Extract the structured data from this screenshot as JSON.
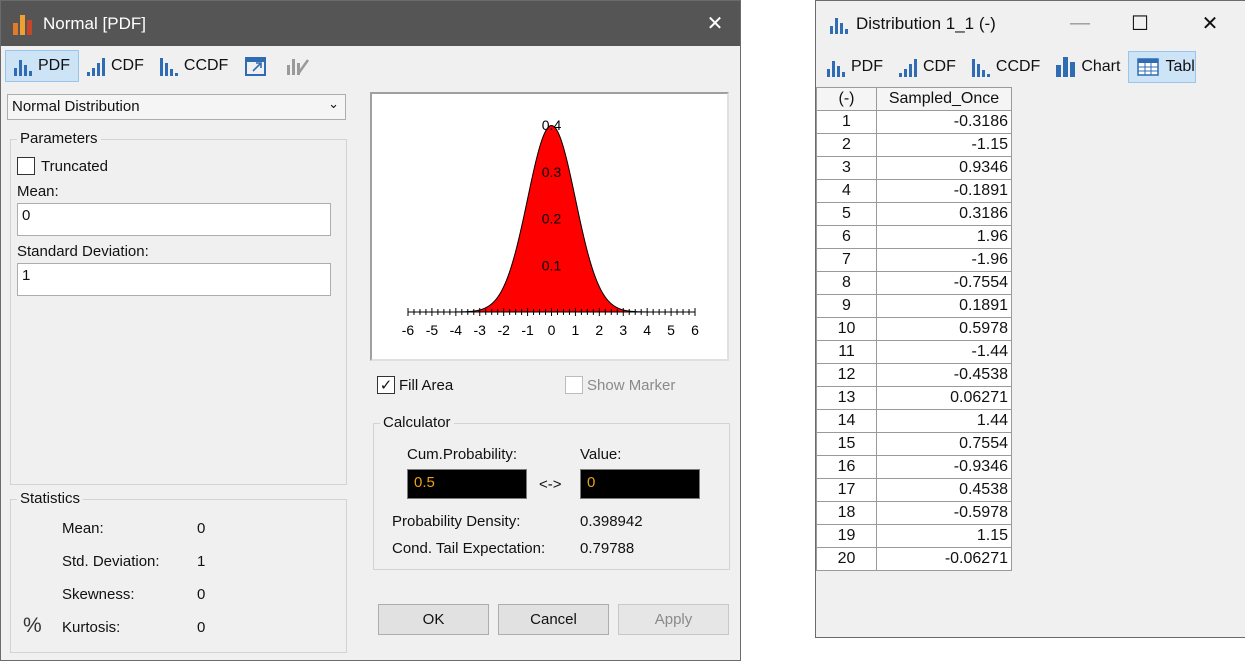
{
  "dialog": {
    "title": "Normal [PDF]",
    "toolbar": {
      "pdf": "PDF",
      "cdf": "CDF",
      "ccdf": "CCDF"
    },
    "distribution_select": "Normal Distribution",
    "parameters": {
      "group_label": "Parameters",
      "truncated_label": "Truncated",
      "mean_label": "Mean:",
      "mean_value": "0",
      "sd_label": "Standard Deviation:",
      "sd_value": "1"
    },
    "statistics": {
      "group_label": "Statistics",
      "rows": [
        {
          "label": "Mean:",
          "value": "0"
        },
        {
          "label": "Std. Deviation:",
          "value": "1"
        },
        {
          "label": "Skewness:",
          "value": "0"
        },
        {
          "label": "Kurtosis:",
          "value": "0"
        }
      ],
      "percent_icon": "%"
    },
    "fill_area_label": "Fill Area",
    "show_marker_label": "Show Marker",
    "calculator": {
      "group_label": "Calculator",
      "cum_prob_label": "Cum.Probability:",
      "cum_prob_value": "0.5",
      "arrow": "<->",
      "value_label": "Value:",
      "value_value": "0",
      "density_label": "Probability Density:",
      "density_value": "0.398942",
      "cte_label": "Cond. Tail Expectation:",
      "cte_value": "0.79788"
    },
    "buttons": {
      "ok": "OK",
      "cancel": "Cancel",
      "apply": "Apply"
    }
  },
  "chart_data": {
    "type": "area",
    "title": "",
    "xlabel": "",
    "ylabel": "",
    "distribution": "normal",
    "mean": 0,
    "sd": 1,
    "xlim": [
      -6,
      6
    ],
    "ylim": [
      0,
      0.4
    ],
    "x_ticks": [
      "-6",
      "-5",
      "-4",
      "-3",
      "-2",
      "-1",
      "0",
      "1",
      "2",
      "3",
      "4",
      "5",
      "6"
    ],
    "y_ticks": [
      "0.1",
      "0.2",
      "0.3",
      "0.4"
    ],
    "fill_color": "#ff0000",
    "x": [
      -4,
      -3.5,
      -3,
      -2.5,
      -2,
      -1.5,
      -1,
      -0.5,
      0,
      0.5,
      1,
      1.5,
      2,
      2.5,
      3,
      3.5,
      4
    ],
    "y": [
      0.0001,
      0.0009,
      0.0044,
      0.0175,
      0.054,
      0.1295,
      0.242,
      0.3521,
      0.3989,
      0.3521,
      0.242,
      0.1295,
      0.054,
      0.0175,
      0.0044,
      0.0009,
      0.0001
    ]
  },
  "distribution_window": {
    "title": "Distribution 1_1 (-)",
    "toolbar": {
      "pdf": "PDF",
      "cdf": "CDF",
      "ccdf": "CCDF",
      "chart": "Chart",
      "table": "Tabl"
    },
    "table": {
      "headers": [
        "(-)",
        "Sampled_Once"
      ],
      "rows": [
        [
          "1",
          "-0.3186"
        ],
        [
          "2",
          "-1.15"
        ],
        [
          "3",
          "0.9346"
        ],
        [
          "4",
          "-0.1891"
        ],
        [
          "5",
          "0.3186"
        ],
        [
          "6",
          "1.96"
        ],
        [
          "7",
          "-1.96"
        ],
        [
          "8",
          "-0.7554"
        ],
        [
          "9",
          "0.1891"
        ],
        [
          "10",
          "0.5978"
        ],
        [
          "11",
          "-1.44"
        ],
        [
          "12",
          "-0.4538"
        ],
        [
          "13",
          "0.06271"
        ],
        [
          "14",
          "1.44"
        ],
        [
          "15",
          "0.7554"
        ],
        [
          "16",
          "-0.9346"
        ],
        [
          "17",
          "0.4538"
        ],
        [
          "18",
          "-0.5978"
        ],
        [
          "19",
          "1.15"
        ],
        [
          "20",
          "-0.06271"
        ]
      ]
    }
  }
}
